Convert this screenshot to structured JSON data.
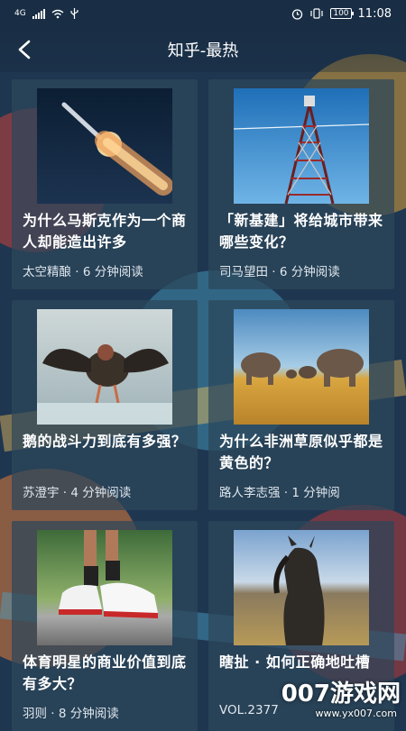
{
  "status_bar": {
    "network": "4G",
    "battery": "100",
    "time": "11:08"
  },
  "header": {
    "title": "知乎-最热"
  },
  "articles": [
    {
      "title": "为什么马斯克作为一个商人却能造出许多",
      "meta": "太空精酿 · 6 分钟阅读",
      "image_icon": "rocket-launch-photo"
    },
    {
      "title": "「新基建」将给城市带来哪些变化？",
      "meta": "司马望田 · 6 分钟阅读",
      "image_icon": "signal-tower-photo"
    },
    {
      "title": "鹅的战斗力到底有多强？",
      "meta": "苏澄宇 · 4 分钟阅读",
      "image_icon": "goose-photo"
    },
    {
      "title": "为什么非洲草原似乎都是黄色的？",
      "meta": "路人李志强 · 1 分钟阅",
      "image_icon": "elephants-savanna-photo"
    },
    {
      "title": "体育明星的商业价值到底有多大？",
      "meta": "羽则 · 8 分钟阅读",
      "image_icon": "sneakers-photo"
    },
    {
      "title": "瞎扯 · 如何正确地吐槽",
      "meta": "VOL.2377",
      "image_icon": "horse-photo"
    }
  ],
  "watermark": {
    "logo": "007游戏网",
    "url": "www.yx007.com"
  },
  "colors": {
    "card_bg": "#2d465a",
    "text": "#ffffff"
  }
}
